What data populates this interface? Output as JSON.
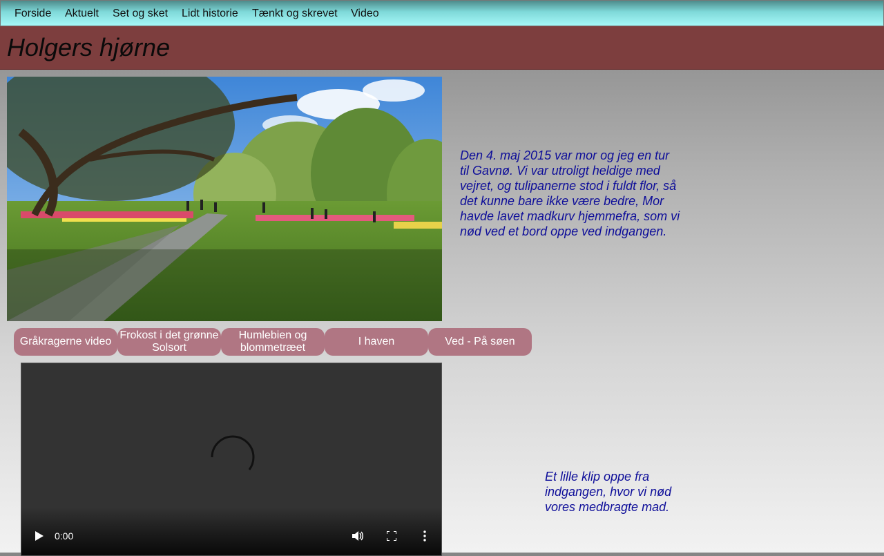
{
  "nav": {
    "items": [
      {
        "label": "Forside"
      },
      {
        "label": "Aktuelt"
      },
      {
        "label": "Set og sket"
      },
      {
        "label": "Lidt historie"
      },
      {
        "label": "Tænkt og skrevet"
      },
      {
        "label": "Video"
      }
    ]
  },
  "header": {
    "title": "Holgers hjørne"
  },
  "intro": {
    "text": "Den 4. maj 2015 var mor og jeg en tur til Gavnø. Vi var utroligt heldige med vejret, og tulipanerne stod i fuldt flor, så det kunne bare ikke være bedre, Mor havde lavet madkurv hjemmefra, som vi nød ved et bord oppe ved indgangen."
  },
  "video_buttons": [
    {
      "label": "Gråkragerne video"
    },
    {
      "label": "Frokost i det grønne Solsort"
    },
    {
      "label": "Humlebien og blommetræet"
    },
    {
      "label": "I haven"
    },
    {
      "label": "Ved - På søen"
    }
  ],
  "video": {
    "time": "0:00",
    "icons": {
      "play": "play-icon",
      "volume": "volume-icon",
      "fullscreen": "fullscreen-icon",
      "more": "more-options-icon",
      "loading": "loading-spinner-icon"
    }
  },
  "caption": {
    "text": "Et lille klip oppe fra indgangen, hvor vi nød vores medbragte mad."
  },
  "colors": {
    "nav_bar": "#7fd9d9",
    "banner": "#7d3e3e",
    "button": "#b07683",
    "body_text": "#0d0d99"
  }
}
